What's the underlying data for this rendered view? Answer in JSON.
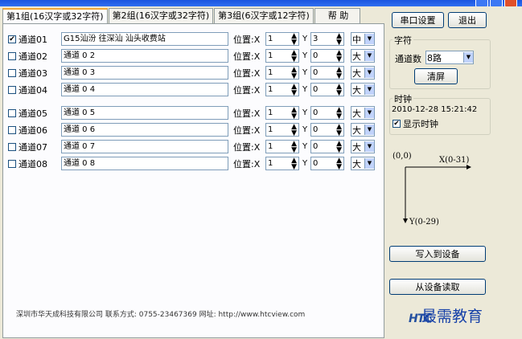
{
  "tabs": [
    {
      "label": "第1组(16汉字或32字符)"
    },
    {
      "label": "第2组(16汉字或32字符)"
    },
    {
      "label": "第3组(6汉字或12字符)"
    },
    {
      "label": "帮 助"
    }
  ],
  "channels": [
    {
      "checked": true,
      "label": "通道01",
      "text": "G15汕汾 往深汕        汕头收费站",
      "x": "1",
      "y": "3",
      "size": "中"
    },
    {
      "checked": false,
      "label": "通道02",
      "text": "通道 0 2",
      "x": "1",
      "y": "0",
      "size": "大"
    },
    {
      "checked": false,
      "label": "通道03",
      "text": "通道 0 3",
      "x": "1",
      "y": "0",
      "size": "大"
    },
    {
      "checked": false,
      "label": "通道04",
      "text": "通道 0 4",
      "x": "1",
      "y": "0",
      "size": "大"
    },
    {
      "checked": false,
      "label": "通道05",
      "text": "通道 0 5",
      "x": "1",
      "y": "0",
      "size": "大"
    },
    {
      "checked": false,
      "label": "通道06",
      "text": "通道 0 6",
      "x": "1",
      "y": "0",
      "size": "大"
    },
    {
      "checked": false,
      "label": "通道07",
      "text": "通道 0 7",
      "x": "1",
      "y": "0",
      "size": "大"
    },
    {
      "checked": false,
      "label": "通道08",
      "text": "通道 0 8",
      "x": "1",
      "y": "0",
      "size": "大"
    }
  ],
  "labels": {
    "position": "位置:X",
    "y": "Y"
  },
  "footer": "深圳市华天成科技有限公司 联系方式: 0755-23467369 网址: http://www.htcview.com",
  "right": {
    "serial_settings": "串口设置",
    "exit": "退出",
    "char_group": "字符",
    "channel_count_label": "通道数",
    "channel_count_value": "8路",
    "clear_screen": "清屏",
    "clock_group": "时钟",
    "datetime": "2010-12-28 15:21:42",
    "show_clock_label": "显示时钟",
    "show_clock_checked": true,
    "origin_label": "(0,0)",
    "x_axis_label": "X(0-31)",
    "y_axis_label": "Y(0-29)",
    "write_device": "写入到设备",
    "read_device": "从设备读取"
  },
  "logo_text": "HTC",
  "watermark": "最需教育"
}
